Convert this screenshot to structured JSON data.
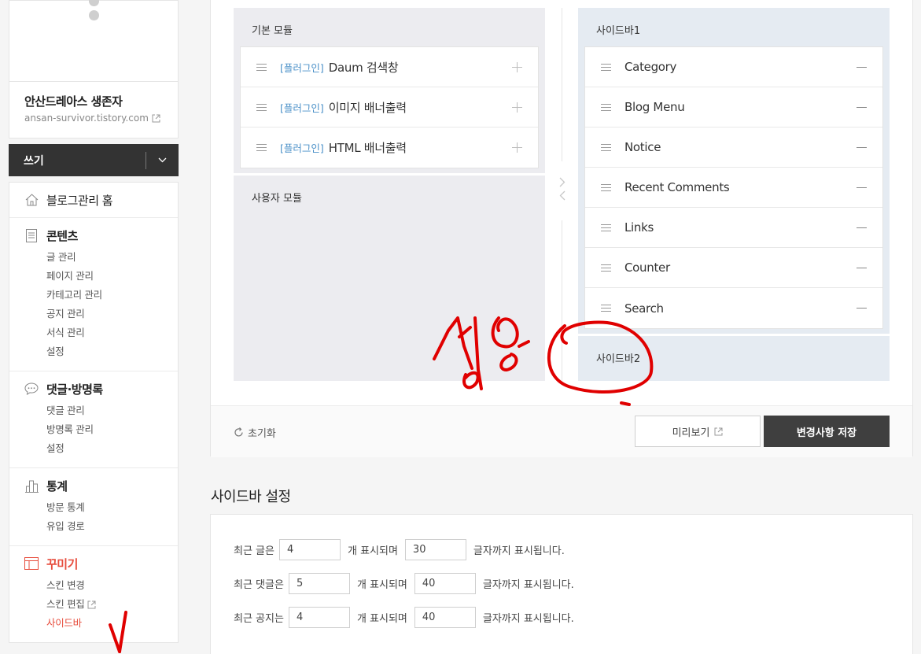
{
  "sidebar": {
    "blog_name": "안산드레아스 생존자",
    "blog_url": "ansan-survivor.tistory.com",
    "write_label": "쓰기",
    "home_label": "블로그관리 홈",
    "sections": [
      {
        "title": "콘텐츠",
        "items": [
          "글 관리",
          "페이지 관리",
          "카테고리 관리",
          "공지 관리",
          "서식 관리",
          "설정"
        ]
      },
      {
        "title": "댓글·방명록",
        "items": [
          "댓글 관리",
          "방명록 관리",
          "설정"
        ]
      },
      {
        "title": "통계",
        "items": [
          "방문 통계",
          "유입 경로"
        ]
      },
      {
        "title": "꾸미기",
        "items": [
          "스킨 변경",
          "스킨 편집",
          "사이드바"
        ]
      }
    ]
  },
  "modules": {
    "basic_title": "기본 모듈",
    "plugin_tag": "[플러그인]",
    "basic_items": [
      "Daum 검색창",
      "이미지 배너출력",
      "HTML 배너출력"
    ],
    "user_title": "사용자 모듈",
    "sidebar1_title": "사이드바1",
    "sidebar1_items": [
      "Category",
      "Blog Menu",
      "Notice",
      "Recent Comments",
      "Links",
      "Counter",
      "Search"
    ],
    "sidebar2_title": "사이드바2"
  },
  "footer": {
    "reset_label": "초기화",
    "preview_label": "미리보기",
    "save_label": "변경사항 저장"
  },
  "settings": {
    "title": "사이드바 설정",
    "rows": [
      {
        "label": "최근 글은",
        "count": "4",
        "mid": "개 표시되며",
        "chars": "30",
        "end": "글자까지 표시됩니다."
      },
      {
        "label": "최근 댓글은",
        "count": "5",
        "mid": "개 표시되며",
        "chars": "40",
        "end": "글자까지 표시됩니다."
      },
      {
        "label": "최근 공지는",
        "count": "4",
        "mid": "개 표시되며",
        "chars": "40",
        "end": "글자까지 표시됩니다."
      }
    ]
  },
  "annotation": {
    "handwritten_text": "생성",
    "color": "#e00000"
  },
  "colors": {
    "accent_red": "#e74c3c",
    "dark_button": "#3f3f3f",
    "plugin_blue": "#4a90c8"
  }
}
